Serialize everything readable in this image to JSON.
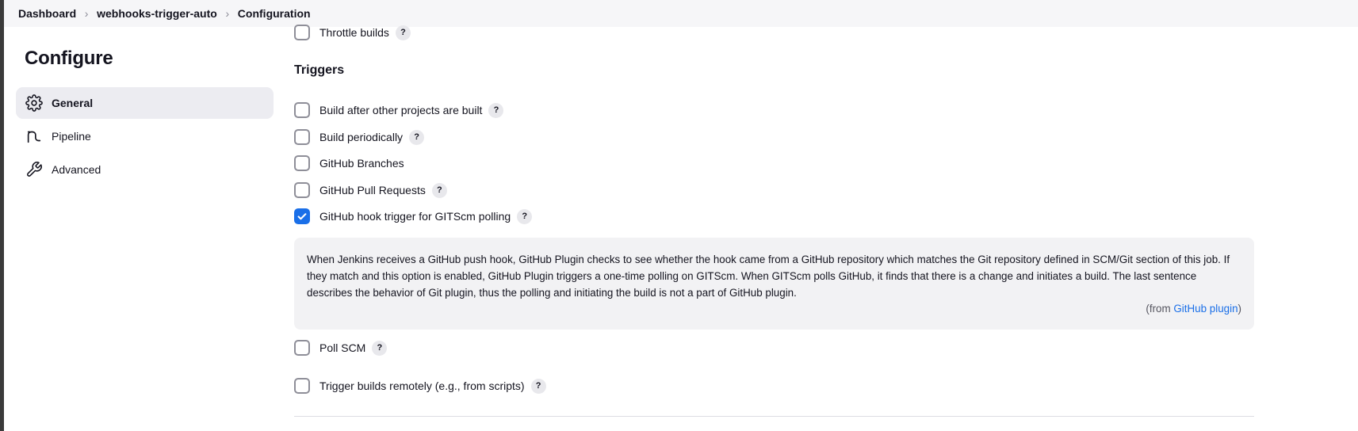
{
  "breadcrumb": {
    "items": [
      "Dashboard",
      "webhooks-trigger-auto",
      "Configuration"
    ]
  },
  "sidebar": {
    "title": "Configure",
    "items": [
      {
        "label": "General",
        "icon": "gear-icon",
        "active": true
      },
      {
        "label": "Pipeline",
        "icon": "pipeline-icon",
        "active": false
      },
      {
        "label": "Advanced",
        "icon": "wrench-icon",
        "active": false
      }
    ]
  },
  "main": {
    "throttle_label": "Throttle builds",
    "triggers_title": "Triggers",
    "triggers": [
      {
        "label": "Build after other projects are built",
        "checked": false,
        "help": true
      },
      {
        "label": "Build periodically",
        "checked": false,
        "help": true
      },
      {
        "label": "GitHub Branches",
        "checked": false,
        "help": false
      },
      {
        "label": "GitHub Pull Requests",
        "checked": false,
        "help": true
      },
      {
        "label": "GitHub hook trigger for GITScm polling",
        "checked": true,
        "help": true
      },
      {
        "label": "Poll SCM",
        "checked": false,
        "help": true
      },
      {
        "label": "Trigger builds remotely (e.g., from scripts)",
        "checked": false,
        "help": true
      }
    ],
    "help_text": "When Jenkins receives a GitHub push hook, GitHub Plugin checks to see whether the hook came from a GitHub repository which matches the Git repository defined in SCM/Git section of this job. If they match and this option is enabled, GitHub Plugin triggers a one-time polling on GITScm. When GITScm polls GitHub, it finds that there is a change and initiates a build. The last sentence describes the behavior of Git plugin, thus the polling and initiating the build is not a part of GitHub plugin.",
    "help_from_prefix": "(from ",
    "help_from_link": "GitHub plugin",
    "help_from_suffix": ")",
    "help_glyph": "?"
  },
  "colors": {
    "accent": "#1a6fe8",
    "active_bg": "#ececf1",
    "panel_bg": "#f2f2f4"
  }
}
